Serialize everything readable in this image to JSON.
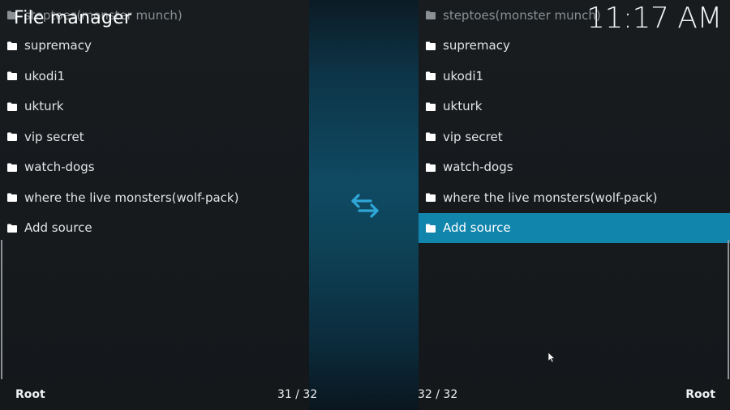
{
  "header": {
    "title": "File manager",
    "clock": "11:17 AM"
  },
  "left_pane": {
    "items": [
      {
        "label": "steptoes(monster munch)"
      },
      {
        "label": "supremacy"
      },
      {
        "label": "ukodi1"
      },
      {
        "label": "ukturk"
      },
      {
        "label": "vip secret"
      },
      {
        "label": "watch-dogs"
      },
      {
        "label": "where the live monsters(wolf-pack)"
      },
      {
        "label": "Add source"
      }
    ],
    "path": "Root",
    "count": "31 / 32"
  },
  "right_pane": {
    "items": [
      {
        "label": "steptoes(monster munch)"
      },
      {
        "label": "supremacy"
      },
      {
        "label": "ukodi1"
      },
      {
        "label": "ukturk"
      },
      {
        "label": "vip secret"
      },
      {
        "label": "watch-dogs"
      },
      {
        "label": "where the live monsters(wolf-pack)"
      },
      {
        "label": "Add source"
      }
    ],
    "selected_index": 7,
    "path": "Root",
    "count": "32 / 32"
  },
  "icons": {
    "folder": "folder-icon",
    "swap": "swap-arrows-icon",
    "cursor": "mouse-pointer-icon"
  },
  "colors": {
    "accent": "#1285ad",
    "swap_icon": "#2fa6d6",
    "background": "#15191c"
  }
}
